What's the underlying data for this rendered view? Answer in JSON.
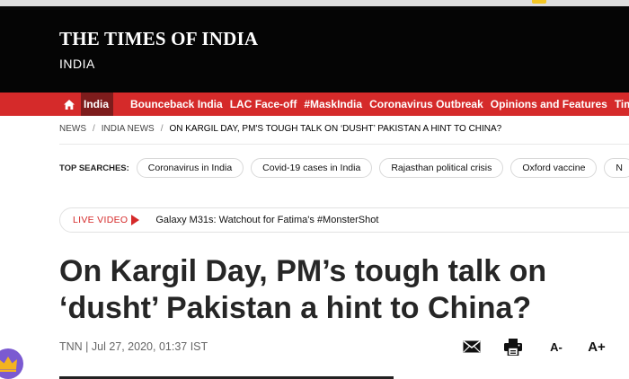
{
  "header": {
    "logo_text": "THE TIMES OF INDIA",
    "edition": "INDIA"
  },
  "nav": {
    "home_icon": "home-icon",
    "active_label": "India",
    "items": [
      {
        "label": "Bounceback India"
      },
      {
        "label": "LAC Face-off"
      },
      {
        "label": "#MaskIndia"
      },
      {
        "label": "Coronavirus Outbreak"
      },
      {
        "label": "Opinions and Features"
      },
      {
        "label": "Times Evoke"
      }
    ]
  },
  "breadcrumb": {
    "items": [
      "NEWS",
      "INDIA NEWS"
    ],
    "separator": "/",
    "current": "ON KARGIL DAY, PM'S TOUGH TALK ON ‘DUSHT’ PAKISTAN A HINT TO CHINA?"
  },
  "top_searches": {
    "label": "TOP SEARCHES:",
    "chips": [
      "Coronavirus in India",
      "Covid-19 cases in India",
      "Rajasthan political crisis",
      "Oxford vaccine",
      "N"
    ]
  },
  "live_video": {
    "label": "LIVE VIDEO",
    "title": "Galaxy M31s: Watchout for Fatima's #MonsterShot"
  },
  "article": {
    "headline": "On Kargil Day, PM’s tough talk on ‘dusht’ Pakistan a hint to China?",
    "byline": "TNN | Jul 27, 2020, 01:37 IST"
  },
  "tools": {
    "font_decrease": "A-",
    "font_increase": "A+"
  },
  "colors": {
    "masthead": "#050505",
    "nav_red": "#d52a2a",
    "nav_active": "#7d1c1c",
    "live_red": "#d52a2a",
    "badge_purple": "#7b5ad1",
    "crown_gold": "#f3b31f"
  }
}
